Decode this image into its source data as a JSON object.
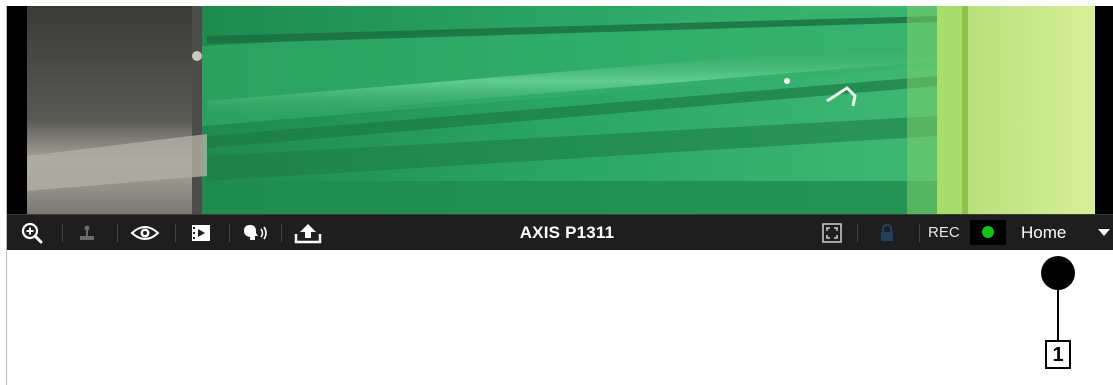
{
  "camera": {
    "title": "AXIS P1311"
  },
  "toolbar": {
    "buttons": [
      {
        "name": "zoom-in-icon",
        "enabled": true
      },
      {
        "name": "joystick-icon",
        "enabled": false
      },
      {
        "name": "eye-icon",
        "enabled": true
      },
      {
        "name": "film-icon",
        "enabled": true
      },
      {
        "name": "speaker-icon",
        "enabled": true
      },
      {
        "name": "upload-icon",
        "enabled": true
      },
      {
        "name": "fullscreen-icon",
        "enabled": true
      },
      {
        "name": "lock-icon",
        "enabled": false
      }
    ],
    "rec_label": "REC",
    "rec_status_color": "#16c21a",
    "preset_label": "Home"
  },
  "callout": {
    "label": "1"
  }
}
